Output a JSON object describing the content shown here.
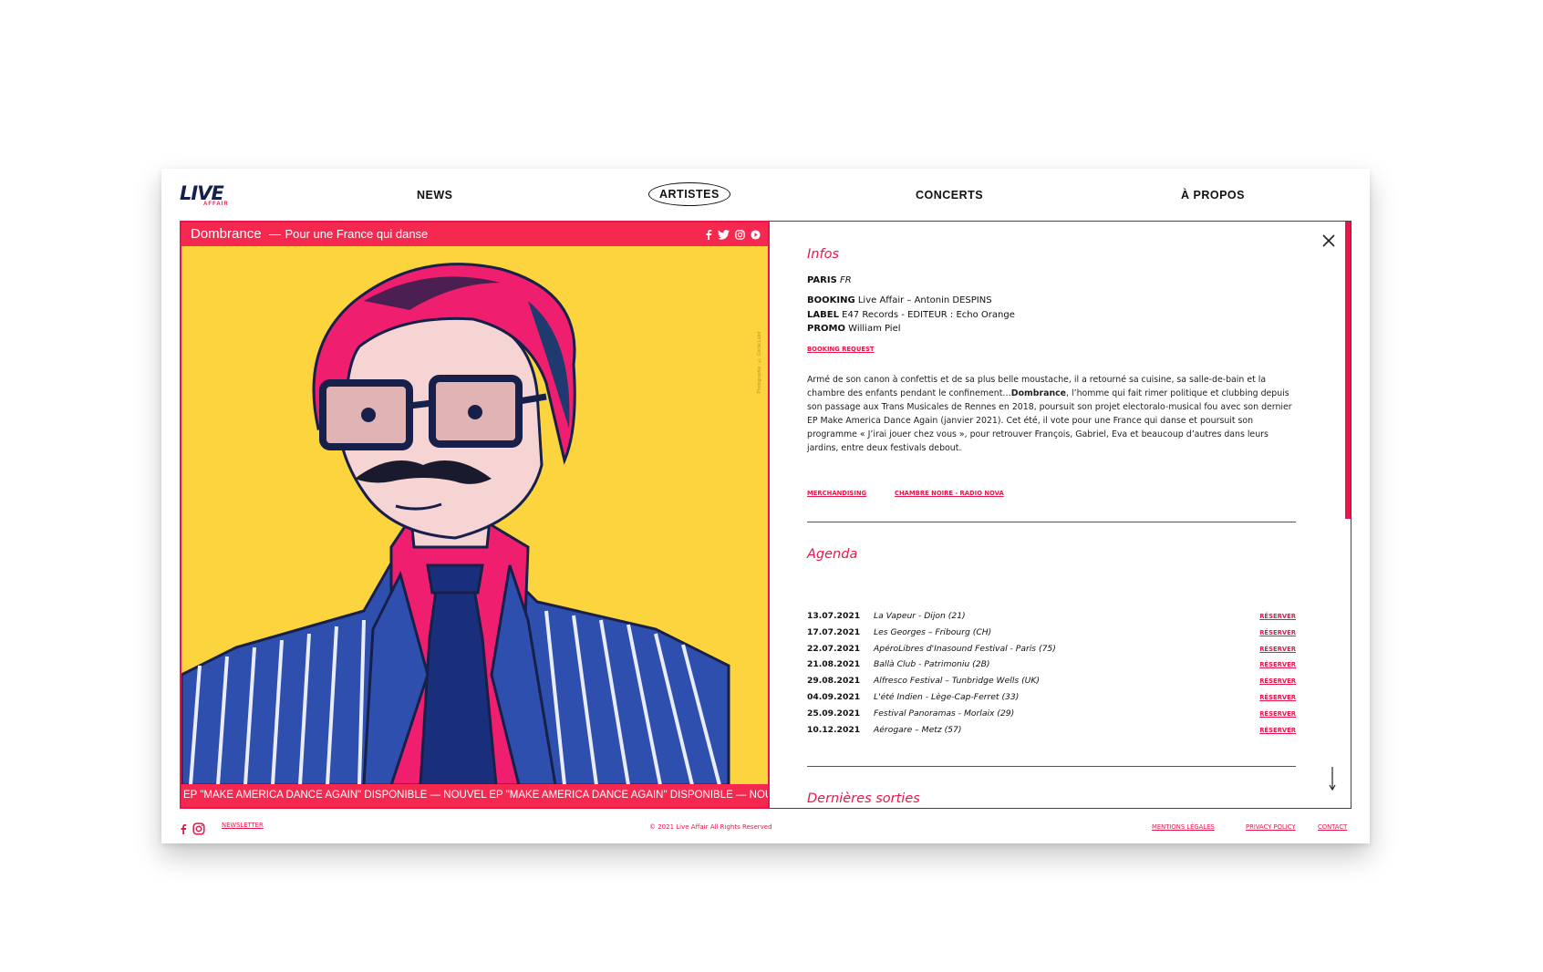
{
  "brand": {
    "logo_main": "LIVE",
    "logo_sub": "AFFAIR"
  },
  "nav": {
    "news": "NEWS",
    "artists": "ARTISTES",
    "concerts": "CONCERTS",
    "about": "À PROPOS"
  },
  "artist": {
    "name": "Dombrance",
    "separator": "—",
    "tagline": "Pour une France qui danse",
    "socials": [
      "facebook-icon",
      "twitter-icon",
      "instagram-icon",
      "play-icon"
    ],
    "photo_credit": "Photographie : © Cécile Lalot",
    "ticker": "EP \"MAKE AMERICA DANCE AGAIN\" DISPONIBLE — NOUVEL EP \"MAKE AMERICA DANCE AGAIN\" DISPONIBLE — NOUVEL EP"
  },
  "infos": {
    "title": "Infos",
    "city": "PARIS",
    "country": "FR",
    "booking_label": "BOOKING",
    "booking_value": "Live Affair – Antonin DESPINS",
    "label_label": "LABEL",
    "label_value": "E47 Records - EDITEUR : Echo Orange",
    "promo_label": "PROMO",
    "promo_value": "William Piel",
    "booking_request": "BOOKING REQUEST",
    "bio_1": "Armé de son canon à confettis et de sa plus belle moustache, il a retourné sa cuisine, sa salle-de-bain et la chambre des enfants pendant le confinement…",
    "bio_bold": "Dombrance",
    "bio_2": ", l’homme qui fait rimer politique et clubbing depuis son passage aux Trans Musicales de Rennes en 2018, poursuit son projet electoralo-musical fou avec son dernier EP Make America Dance Again (janvier 2021). Cet été, il vote pour une France qui danse et poursuit son programme « J’irai jouer chez vous », pour retrouver François, Gabriel, Eva et beaucoup d’autres dans leurs jardins, entre deux festivals debout.",
    "link_merch": "MERCHANDISING",
    "link_radio": "CHAMBRE NOIRE - RADIO NOVA"
  },
  "agenda": {
    "title": "Agenda",
    "book_label": "RÉSERVER",
    "events": [
      {
        "date": "13.07.2021",
        "venue": "La Vapeur - Dijon (21)"
      },
      {
        "date": "17.07.2021",
        "venue": "Les Georges – Fribourg (CH)"
      },
      {
        "date": "22.07.2021",
        "venue": "ApéroLibres d'Inasound Festival - Paris (75)"
      },
      {
        "date": "21.08.2021",
        "venue": "Ballà Club - Patrimoniu (2B)"
      },
      {
        "date": "29.08.2021",
        "venue": "Alfresco Festival – Tunbridge Wells (UK)"
      },
      {
        "date": "04.09.2021",
        "venue": "L'été Indien - Lège-Cap-Ferret (33)"
      },
      {
        "date": "25.09.2021",
        "venue": "Festival Panoramas - Morlaix (29)"
      },
      {
        "date": "10.12.2021",
        "venue": "Aérogare – Metz (57)"
      }
    ]
  },
  "releases": {
    "title": "Dernières sorties"
  },
  "footer": {
    "newsletter": "NEWSLETTER",
    "copyright": "© 2021 Live Affair All Rights Reserved",
    "legal": "MENTIONS LÉGALES",
    "privacy": "PRIVACY POLICY",
    "contact": "CONTACT"
  },
  "colors": {
    "accent": "#e8174a",
    "banner": "#f5284f",
    "portrait_bg": "#fcd43e",
    "navy": "#16204a"
  }
}
